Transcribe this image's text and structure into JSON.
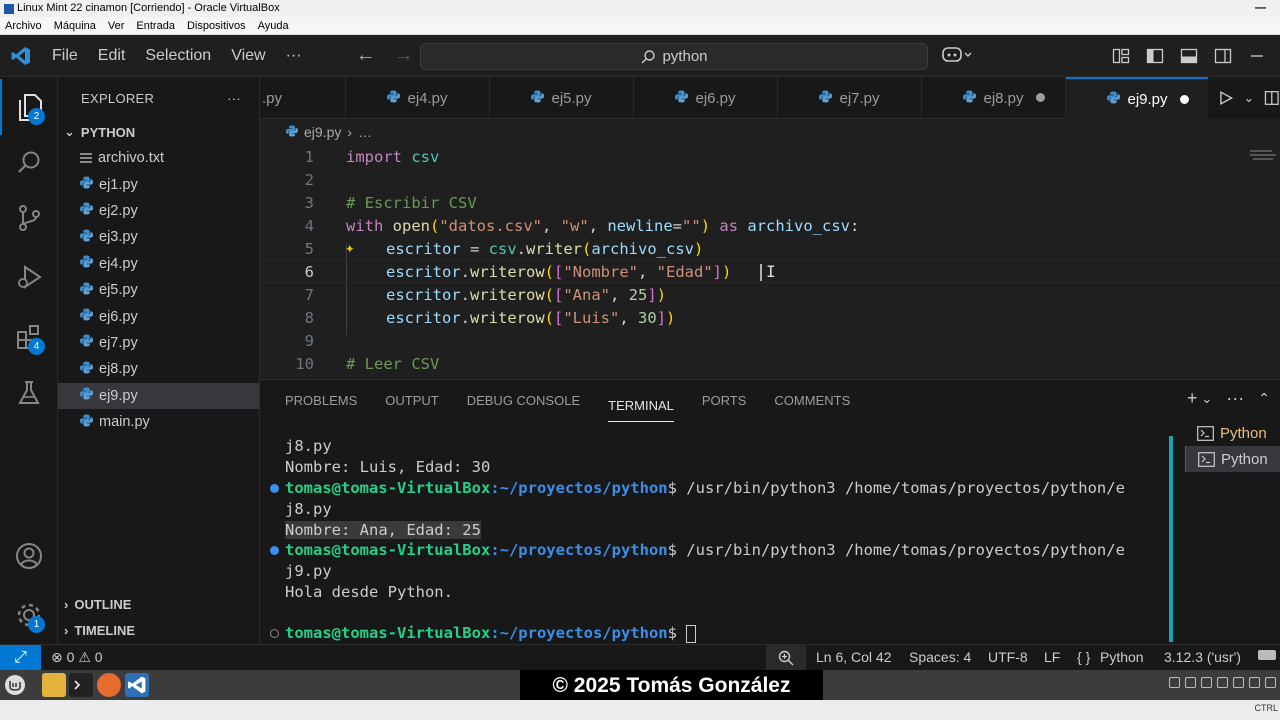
{
  "vbox": {
    "title": "Linux Mint 22 cinamon [Corriendo] - Oracle VirtualBox",
    "menu": [
      "Archivo",
      "Máquina",
      "Ver",
      "Entrada",
      "Dispositivos",
      "Ayuda"
    ]
  },
  "titlebar": {
    "menu": [
      "File",
      "Edit",
      "Selection",
      "View",
      "···"
    ],
    "search_text": "python"
  },
  "activity": {
    "explorer_badge": "2",
    "extensions_badge": "4",
    "manage_badge": "1"
  },
  "explorer": {
    "header": "EXPLORER",
    "more": "···",
    "folder": "PYTHON",
    "files": [
      "archivo.txt",
      "ej1.py",
      "ej2.py",
      "ej3.py",
      "ej4.py",
      "ej5.py",
      "ej6.py",
      "ej7.py",
      "ej8.py",
      "ej9.py",
      "main.py"
    ],
    "selected": "ej9.py",
    "outline": "OUTLINE",
    "timeline": "TIMELINE"
  },
  "tabs": {
    "first": ".py",
    "items": [
      "ej4.py",
      "ej5.py",
      "ej6.py",
      "ej7.py",
      "ej8.py",
      "ej9.py"
    ],
    "active": "ej9.py"
  },
  "editor": {
    "breadcrumb_file": "ej9.py",
    "breadcrumb_more": "…",
    "line_numbers": [
      "1",
      "2",
      "3",
      "4",
      "5",
      "6",
      "7",
      "8",
      "9",
      "10"
    ],
    "current_line": "6",
    "lines": {
      "l1_kw": "import",
      "l1_mod": " csv",
      "l3": "# Escribir CSV",
      "l4_kw": "with",
      "l4_fn": " open",
      "l4_p1": "(",
      "l4_s1": "\"datos.csv\"",
      "l4_c1": ", ",
      "l4_s2": "\"w\"",
      "l4_c2": ", ",
      "l4_kwarg": "newline",
      "l4_eq": "=",
      "l4_s3": "\"\"",
      "l4_p2": ")",
      "l4_as": " as ",
      "l4_var": "archivo_csv",
      "l4_colon": ":",
      "l5_var": "escritor",
      "l5_eq": " = ",
      "l5_mod": "csv",
      "l5_dot": ".",
      "l5_fn": "writer",
      "l5_p1": "(",
      "l5_arg": "archivo_csv",
      "l5_p2": ")",
      "l6_var": "escritor",
      "l6_dot": ".",
      "l6_fn": "writerow",
      "l6_p1": "(",
      "l6_b1": "[",
      "l6_s1": "\"Nombre\"",
      "l6_c": ", ",
      "l6_s2": "\"Edad\"",
      "l6_b2": "]",
      "l6_p2": ")",
      "l7_var": "escritor",
      "l7_dot": ".",
      "l7_fn": "writerow",
      "l7_p1": "(",
      "l7_b1": "[",
      "l7_s1": "\"Ana\"",
      "l7_c": ", ",
      "l7_n": "25",
      "l7_b2": "]",
      "l7_p2": ")",
      "l8_var": "escritor",
      "l8_dot": ".",
      "l8_fn": "writerow",
      "l8_p1": "(",
      "l8_b1": "[",
      "l8_s1": "\"Luis\"",
      "l8_c": ", ",
      "l8_n": "30",
      "l8_b2": "]",
      "l8_p2": ")",
      "l10": "# Leer CSV"
    }
  },
  "panel": {
    "tabs": [
      "PROBLEMS",
      "OUTPUT",
      "DEBUG CONSOLE",
      "TERMINAL",
      "PORTS",
      "COMMENTS"
    ],
    "active_tab": "TERMINAL",
    "terminal": {
      "user": "tomas@tomas-VirtualBox",
      "path": ":~/proyectos/python",
      "dollar": "$",
      "line1": "j8.py",
      "line2": "Nombre: Luis, Edad: 30",
      "cmd": " /usr/bin/python3 /home/tomas/proyectos/python/e",
      "line4": "j8.py",
      "line5": "Nombre: Ana, Edad: 25",
      "line7": "j9.py",
      "line8": "Hola desde Python."
    },
    "terminals": [
      "Python",
      "Python"
    ]
  },
  "status": {
    "errors": "0",
    "warnings": "0",
    "position": "Ln 6, Col 42",
    "spaces": "Spaces: 4",
    "encoding": "UTF-8",
    "eol": "LF",
    "language_braces": "{ }",
    "language": "Python",
    "interpreter": "3.12.3 ('usr')"
  },
  "watermark": "© 2025 Tomás González",
  "tray_label": "CTRL",
  "colors": {
    "accent": "#0078d4",
    "terminal_scroll": "#1aa3b8",
    "prompt_user": "#23d18b",
    "prompt_path": "#3b8eea"
  }
}
